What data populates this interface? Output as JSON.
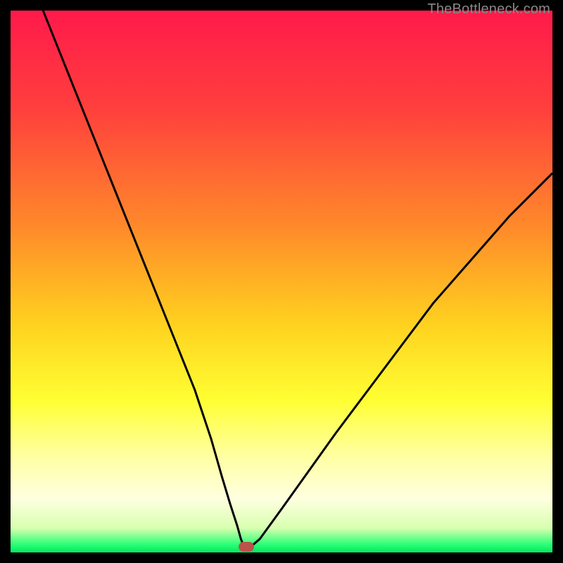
{
  "watermark": "TheBottleneck.com",
  "colors": {
    "bg": "#000000",
    "gradient_stops": [
      {
        "offset": 0.0,
        "color": "#ff1a4b"
      },
      {
        "offset": 0.18,
        "color": "#ff3f3d"
      },
      {
        "offset": 0.4,
        "color": "#ff8a2a"
      },
      {
        "offset": 0.58,
        "color": "#ffd21f"
      },
      {
        "offset": 0.72,
        "color": "#ffff33"
      },
      {
        "offset": 0.82,
        "color": "#ffffa0"
      },
      {
        "offset": 0.9,
        "color": "#ffffe0"
      },
      {
        "offset": 0.955,
        "color": "#d8ffb0"
      },
      {
        "offset": 0.985,
        "color": "#2bff76"
      },
      {
        "offset": 1.0,
        "color": "#00e860"
      }
    ],
    "curve": "#000000",
    "marker": "#b9534c"
  },
  "chart_data": {
    "type": "line",
    "title": "",
    "xlabel": "",
    "ylabel": "",
    "xlim": [
      0,
      100
    ],
    "ylim": [
      0,
      100
    ],
    "series": [
      {
        "name": "bottleneck-curve",
        "x": [
          6,
          10,
          14,
          18,
          22,
          26,
          30,
          34,
          37,
          39,
          40.5,
          41.8,
          42.5,
          43,
          44.5,
          46,
          50,
          55,
          60,
          66,
          72,
          78,
          85,
          92,
          100
        ],
        "y": [
          100,
          90,
          80,
          70,
          60,
          50,
          40,
          30,
          21,
          14,
          9,
          5,
          2.5,
          1.2,
          1.2,
          2.5,
          8,
          15,
          22,
          30,
          38,
          46,
          54,
          62,
          70
        ]
      }
    ],
    "marker": {
      "x": 43.5,
      "y": 1.0
    }
  }
}
